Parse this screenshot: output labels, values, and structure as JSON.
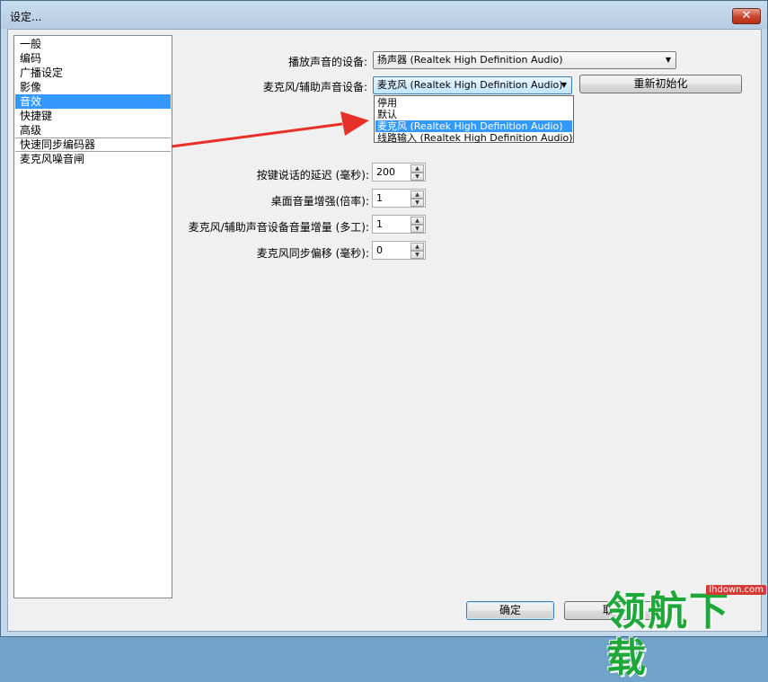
{
  "window": {
    "title": "设定...",
    "close_label": "✕"
  },
  "nav": {
    "items": [
      {
        "label": "一般"
      },
      {
        "label": "编码"
      },
      {
        "label": "广播设定"
      },
      {
        "label": "影像"
      },
      {
        "label": "音效",
        "selected": true
      },
      {
        "label": "快捷键"
      },
      {
        "label": "高级"
      },
      {
        "label": "快速同步编码器"
      },
      {
        "label": "麦克风噪音闸"
      }
    ]
  },
  "audio": {
    "playback_label": "播放声音的设备:",
    "playback_value": "扬声器 (Realtek High Definition Audio)",
    "mic_label": "麦克风/辅助声音设备:",
    "mic_value": "麦克风 (Realtek High Definition Audio)",
    "reinit_button": "重新初始化",
    "mic_options": [
      "停用",
      "默认",
      "麦克风 (Realtek High Definition Audio)",
      "线路输入 (Realtek High Definition Audio)"
    ],
    "ptt_delay_label": "按键说话的延迟 (毫秒):",
    "ptt_delay_value": "200",
    "desktop_boost_label": "桌面音量增强(倍率):",
    "desktop_boost_value": "1",
    "mic_boost_label": "麦克风/辅助声音设备音量增量 (多工):",
    "mic_boost_value": "1",
    "mic_offset_label": "麦克风同步偏移 (毫秒):",
    "mic_offset_value": "0"
  },
  "footer": {
    "ok_button": "确定",
    "cancel_button": "取"
  },
  "watermark": {
    "text": "领航下载",
    "url": "lhdown.com"
  },
  "colors": {
    "selection": "#3399ff",
    "annotation_arrow": "#e8302a",
    "watermark_green": "#1ea83a"
  }
}
